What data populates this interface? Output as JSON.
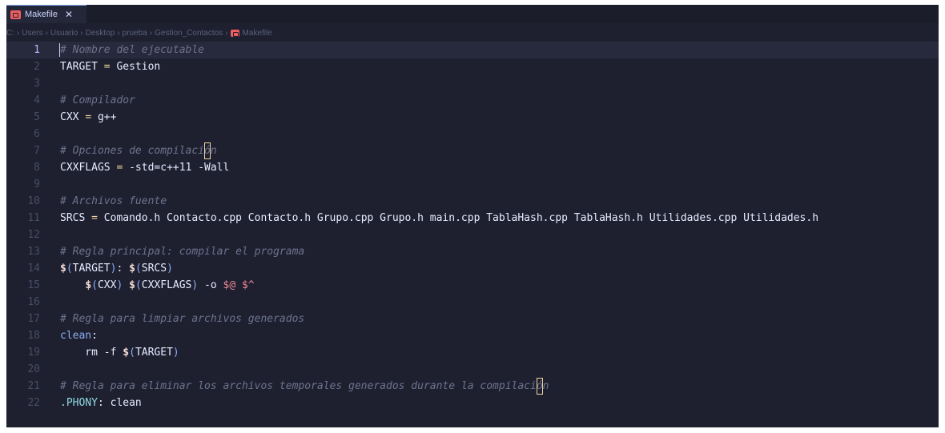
{
  "tab": {
    "label": "Makefile",
    "close": "✕",
    "icon": "makefile-icon"
  },
  "breadcrumb": [
    "C:",
    "Users",
    "Usuario",
    "Desktop",
    "prueba",
    "Gestion_Contactos",
    "Makefile"
  ],
  "current_line": 1,
  "lines": [
    {
      "n": "1",
      "tokens": [
        {
          "c": "comment",
          "t": "# Nombre del ejecutable"
        }
      ]
    },
    {
      "n": "2",
      "tokens": [
        {
          "c": "var",
          "t": "TARGET"
        },
        {
          "c": "plain",
          "t": " "
        },
        {
          "c": "op",
          "t": "="
        },
        {
          "c": "plain",
          "t": " Gestion"
        }
      ]
    },
    {
      "n": "3",
      "tokens": []
    },
    {
      "n": "4",
      "tokens": [
        {
          "c": "comment",
          "t": "# Compilador"
        }
      ]
    },
    {
      "n": "5",
      "tokens": [
        {
          "c": "var",
          "t": "CXX"
        },
        {
          "c": "plain",
          "t": " "
        },
        {
          "c": "op",
          "t": "="
        },
        {
          "c": "plain",
          "t": " g++"
        }
      ]
    },
    {
      "n": "6",
      "tokens": []
    },
    {
      "n": "7",
      "tokens": [
        {
          "c": "comment",
          "t": "# Opciones de compilaci"
        },
        {
          "c": "comment box",
          "t": "ó"
        },
        {
          "c": "comment",
          "t": "n"
        }
      ]
    },
    {
      "n": "8",
      "tokens": [
        {
          "c": "var",
          "t": "CXXFLAGS"
        },
        {
          "c": "plain",
          "t": " "
        },
        {
          "c": "op",
          "t": "="
        },
        {
          "c": "plain",
          "t": " -std=c++11 -Wall"
        }
      ]
    },
    {
      "n": "9",
      "tokens": []
    },
    {
      "n": "10",
      "tokens": [
        {
          "c": "comment",
          "t": "# Archivos fuente"
        }
      ]
    },
    {
      "n": "11",
      "tokens": [
        {
          "c": "var",
          "t": "SRCS"
        },
        {
          "c": "plain",
          "t": " "
        },
        {
          "c": "op",
          "t": "="
        },
        {
          "c": "plain",
          "t": " Comando.h Contacto.cpp Contacto.h Grupo.cpp Grupo.h main.cpp TablaHash.cpp TablaHash.h Utilidades.cpp Utilidades.h"
        }
      ]
    },
    {
      "n": "12",
      "tokens": []
    },
    {
      "n": "13",
      "tokens": [
        {
          "c": "comment",
          "t": "# Regla principal: compilar el programa"
        }
      ]
    },
    {
      "n": "14",
      "tokens": [
        {
          "c": "dollar",
          "t": "$"
        },
        {
          "c": "target",
          "t": "("
        },
        {
          "c": "var",
          "t": "TARGET"
        },
        {
          "c": "target",
          "t": ")"
        },
        {
          "c": "plain",
          "t": ": "
        },
        {
          "c": "dollar",
          "t": "$"
        },
        {
          "c": "target",
          "t": "("
        },
        {
          "c": "var",
          "t": "SRCS"
        },
        {
          "c": "target",
          "t": ")"
        }
      ]
    },
    {
      "n": "15",
      "tokens": [
        {
          "c": "plain",
          "t": "    "
        },
        {
          "c": "dollar",
          "t": "$"
        },
        {
          "c": "target",
          "t": "("
        },
        {
          "c": "var",
          "t": "CXX"
        },
        {
          "c": "target",
          "t": ")"
        },
        {
          "c": "plain",
          "t": " "
        },
        {
          "c": "dollar",
          "t": "$"
        },
        {
          "c": "target",
          "t": "("
        },
        {
          "c": "var",
          "t": "CXXFLAGS"
        },
        {
          "c": "target",
          "t": ")"
        },
        {
          "c": "plain",
          "t": " -o "
        },
        {
          "c": "auto",
          "t": "$@"
        },
        {
          "c": "plain",
          "t": " "
        },
        {
          "c": "auto",
          "t": "$^"
        }
      ]
    },
    {
      "n": "16",
      "tokens": []
    },
    {
      "n": "17",
      "tokens": [
        {
          "c": "comment",
          "t": "# Regla para limpiar archivos generados"
        }
      ]
    },
    {
      "n": "18",
      "tokens": [
        {
          "c": "target",
          "t": "clean"
        },
        {
          "c": "plain",
          "t": ":"
        }
      ]
    },
    {
      "n": "19",
      "tokens": [
        {
          "c": "plain",
          "t": "    rm -f "
        },
        {
          "c": "dollar",
          "t": "$"
        },
        {
          "c": "target",
          "t": "("
        },
        {
          "c": "var",
          "t": "TARGET"
        },
        {
          "c": "target",
          "t": ")"
        }
      ]
    },
    {
      "n": "20",
      "tokens": []
    },
    {
      "n": "21",
      "tokens": [
        {
          "c": "comment",
          "t": "# Regla para eliminar los archivos temporales generados durante la compilaci"
        },
        {
          "c": "comment box",
          "t": "ó"
        },
        {
          "c": "comment",
          "t": "n"
        }
      ]
    },
    {
      "n": "22",
      "tokens": [
        {
          "c": "phony",
          "t": ".PHONY"
        },
        {
          "c": "plain",
          "t": ": clean"
        }
      ]
    }
  ],
  "colors": {
    "background": "#1e2030",
    "comment": "#6e738d",
    "keyword": "#8aadf4",
    "auto_var": "#ed8796",
    "bracket_highlight": "#eed49f"
  }
}
